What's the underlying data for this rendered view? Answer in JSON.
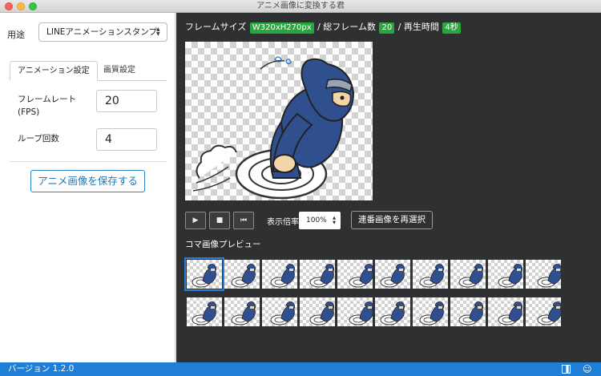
{
  "window": {
    "title": "アニメ画像に変換する君"
  },
  "sidebar": {
    "purpose_label": "用途",
    "purpose_value": "LINEアニメーションスタンプ",
    "tabs": [
      {
        "label": "アニメーション設定",
        "active": true
      },
      {
        "label": "画質設定",
        "active": false
      }
    ],
    "fps_label_line1": "フレームレート",
    "fps_label_line2": "(FPS)",
    "fps_value": "20",
    "loop_label": "ループ回数",
    "loop_value": "4",
    "save_button": "アニメ画像を保存する"
  },
  "main": {
    "frame_size_label": "フレームサイズ",
    "frame_size_value": "W320xH270px",
    "total_frames_label": "/ 総フレーム数",
    "total_frames_value": "20",
    "duration_label": "/ 再生時間",
    "duration_value": "4秒",
    "controls": {
      "play_icon": "▶",
      "stop_icon": "■",
      "rewind_icon": "⏮"
    },
    "zoom_label": "表示倍率",
    "zoom_value": "100%",
    "reselect_button": "連番画像を再選択",
    "frames_title": "コマ画像プレビュー",
    "frame_count": 20,
    "selected_frame": 1
  },
  "status": {
    "version": "バージョン 1.2.0"
  },
  "colors": {
    "accent_blue": "#1f7fd6",
    "badge_green": "#2aa63f",
    "ninja_blue": "#2f4f8f",
    "dark_panel": "#2e3032"
  }
}
